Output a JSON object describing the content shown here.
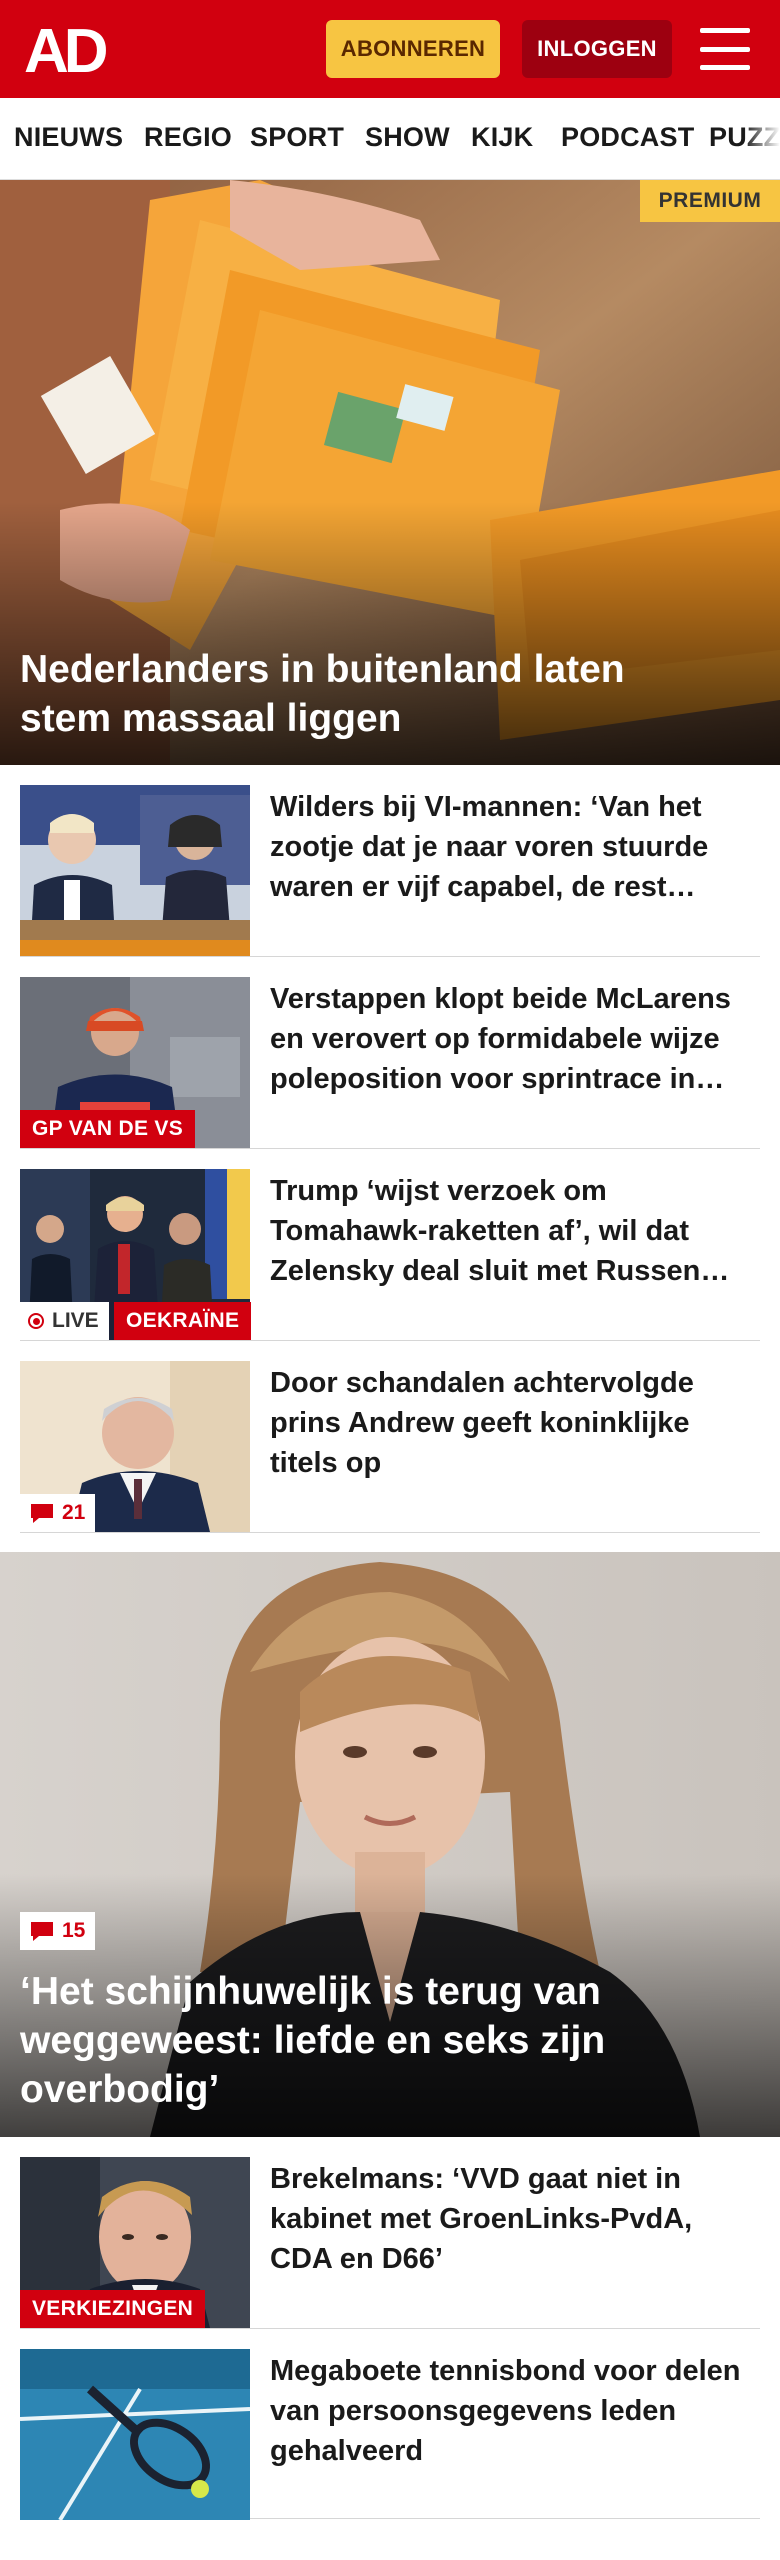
{
  "header": {
    "logo_text": "AD",
    "subscribe_label": "ABONNEREN",
    "login_label": "INLOGGEN",
    "brand_color": "#d1000f"
  },
  "nav": {
    "items": [
      "NIEUWS",
      "REGIO",
      "SPORT",
      "SHOW",
      "KIJK",
      "PODCAST",
      "PUZZ"
    ]
  },
  "hero": {
    "badge": "PREMIUM",
    "title": "Nederlanders in buitenland laten stem massaal liggen"
  },
  "articles": [
    {
      "title": "Wilders bij VI-mannen: ‘Van het zootje dat je naar voren stuurde waren er vijf capabel, de rest…"
    },
    {
      "title": "Verstappen klopt beide McLarens en verovert op formidabele wijze poleposition voor sprintrace in…",
      "tag": "GP VAN DE VS"
    },
    {
      "title": "Trump ‘wijst verzoek om Tomahawk-raketten af’, wil dat Zelensky deal sluit met Russen…",
      "live_label": "LIVE",
      "tag": "OEKRAÏNE"
    },
    {
      "title": "Door schandalen achtervolgde prins Andrew geeft koninklijke titels op",
      "comment_count": "21"
    }
  ],
  "feature": {
    "comment_count": "15",
    "title": "‘Het schijnhuwelijk is terug van weggeweest: liefde en seks zijn overbodig’"
  },
  "articles2": [
    {
      "title": "Brekelmans: ‘VVD gaat niet in kabinet met GroenLinks-PvdA, CDA en D66’",
      "tag": "VERKIEZINGEN"
    },
    {
      "title": "Megaboete tennisbond voor delen van persoonsgegevens leden gehalveerd"
    }
  ]
}
